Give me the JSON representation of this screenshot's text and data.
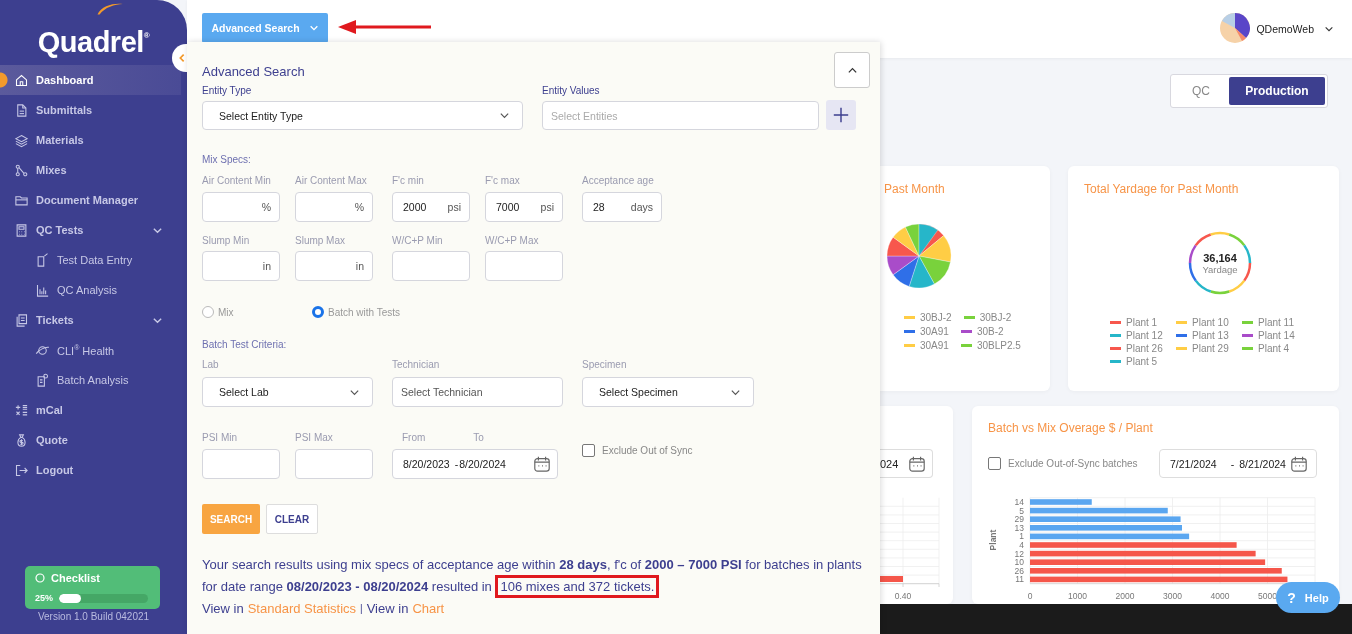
{
  "sidebar": {
    "logo": "Quadrel$^{®}$",
    "items": [
      {
        "label": "Dashboard",
        "selected": true
      },
      {
        "label": "Submittals",
        "selected": false
      },
      {
        "label": "Materials",
        "selected": false
      },
      {
        "label": "Mixes",
        "selected": false
      },
      {
        "label": "Document Manager",
        "selected": false
      },
      {
        "label": "QC Tests",
        "selected": false,
        "expanded": true,
        "children": [
          {
            "label": "Test Data Entry",
            "selected": false
          },
          {
            "label": "QC Analysis",
            "selected": false
          }
        ]
      },
      {
        "label": "Tickets",
        "selected": false,
        "expanded": true,
        "children": [
          {
            "label": "CLI$^{®}$ Health",
            "selected": false
          },
          {
            "label": "Batch Analysis",
            "selected": false
          }
        ]
      },
      {
        "label": "mCal",
        "selected": false
      },
      {
        "label": "Quote",
        "selected": false
      },
      {
        "label": "Logout",
        "selected": false
      }
    ],
    "checklist": {
      "label": "Checklist",
      "percent": "25%",
      "level": 0.25
    },
    "version": "Version 1.0 Build 042021"
  },
  "header": {
    "advanced_search_button": "Advanced Search",
    "annotation_arrow": true,
    "user": "QDemoWeb"
  },
  "mode_tabs": [
    {
      "label": "QC",
      "selected": false
    },
    {
      "label": "Production",
      "selected": true
    }
  ],
  "advanced_search": {
    "title": "Advanced Search",
    "entity_type": {
      "label": "Entity Type",
      "value": "Select Entity Type"
    },
    "entity_values": {
      "label": "Entity Values",
      "placeholder": "Select Entities"
    },
    "mix_specs_heading": "Mix Specs:",
    "mix_spec_rows": [
      [
        {
          "label": "Air Content Min",
          "unit": "%"
        },
        {
          "label": "Air Content Max",
          "unit": "%"
        },
        {
          "label": "F'c min",
          "value": "2000",
          "unit": "psi"
        },
        {
          "label": "F'c max",
          "value": "7000",
          "unit": "psi"
        },
        {
          "label": "Acceptance age",
          "value": "28",
          "unit": "days"
        }
      ],
      [
        {
          "label": "Slump Min",
          "unit": "in"
        },
        {
          "label": "Slump Max",
          "unit": "in"
        },
        {
          "label": "W/C+P Min"
        },
        {
          "label": "W/C+P Max"
        }
      ]
    ],
    "record_types": [
      {
        "label": "Mix",
        "selected": false
      },
      {
        "label": "Batch with Tests",
        "selected": true
      }
    ],
    "batch_heading": "Batch Test Criteria:",
    "lab": {
      "label": "Lab",
      "value": "Select Lab"
    },
    "technician": {
      "label": "Technician",
      "placeholder": "Select Technician"
    },
    "specimen": {
      "label": "Specimen",
      "value": "Select Specimen"
    },
    "psi_min": {
      "label": "PSI Min"
    },
    "psi_max": {
      "label": "PSI Max"
    },
    "date_range": {
      "from_label": "From",
      "to_label": "To",
      "start": "8/20/2023",
      "separator": "-",
      "end": "8/20/2024"
    },
    "exclude_out_of_sync": {
      "label": "Exclude Out of Sync",
      "checked": false
    },
    "buttons": [
      "SEARCH",
      "CLEAR"
    ],
    "summary": {
      "text": "Your search results using mix specs of acceptance age within **28 days**, f'c of **2000 – 7000 PSI** for batches in plants for date range **08/20/2023 - 08/20/2024** resulted in ",
      "highlighted": "106 mixes and 372 tickets."
    },
    "view_links": [
      {
        "prefix": "View in",
        "link": "Standard Statistics"
      },
      {
        "prefix": "View in",
        "link": "Chart"
      }
    ],
    "view_links_separator": "|"
  },
  "pie_card": {
    "title": "Past Month",
    "legend": [
      {
        "label": "30BJ-2",
        "color": "#ffcd45"
      },
      {
        "label": "30BJ-2",
        "color": "#79d23c"
      },
      {
        "label": "30A91",
        "color": "#2f6fe8"
      },
      {
        "label": "30B-2",
        "color": "#a94cc9"
      },
      {
        "label": "30A91",
        "color": "#ffcd45"
      },
      {
        "label": "30BLP2.5",
        "color": "#79d23c"
      }
    ]
  },
  "yardage_card": {
    "title": "Total Yardage for Past Month",
    "total": "36,164",
    "unit": "Yardage",
    "legend": [
      {
        "label": "Plant 1",
        "color": "#f7574d"
      },
      {
        "label": "Plant 10",
        "color": "#ffcd45"
      },
      {
        "label": "Plant 11",
        "color": "#79d23c"
      },
      {
        "label": "Plant 12",
        "color": "#26b6c9"
      },
      {
        "label": "Plant 13",
        "color": "#2f6fe8"
      },
      {
        "label": "Plant 14",
        "color": "#a94cc9"
      },
      {
        "label": "Plant 26",
        "color": "#f7574d"
      },
      {
        "label": "Plant 29",
        "color": "#ffcd45"
      },
      {
        "label": "Plant 4",
        "color": "#79d23c"
      },
      {
        "label": "Plant 5",
        "color": "#26b6c9"
      }
    ]
  },
  "left_chart_card": {
    "date_fragment": "024",
    "tick": "0.40"
  },
  "overage_card": {
    "title": "Batch vs Mix Overage $ / Plant",
    "exclude": {
      "label": "Exclude Out-of-Sync batches",
      "checked": false
    },
    "start": "7/21/2024",
    "separator": "-",
    "end": "8/21/2024",
    "chart_data": {
      "type": "bar",
      "orientation": "horizontal",
      "ylabel": "Plant",
      "stacked": true,
      "grid": true,
      "categories": [
        "14",
        "5",
        "29",
        "13",
        "1",
        "4",
        "12",
        "10",
        "26",
        "11"
      ],
      "xlim": [
        0,
        6000
      ],
      "xticks": [
        0,
        1000,
        2000,
        3000,
        4000,
        5000
      ],
      "series": [
        {
          "color": "#5aa6f0",
          "values": [
            1300,
            2900,
            3170,
            3200,
            3350,
            null,
            null,
            null,
            null,
            null
          ]
        },
        {
          "color": "#f5564a",
          "values": [
            null,
            null,
            null,
            null,
            null,
            4350,
            4750,
            4950,
            5300,
            5420
          ]
        }
      ]
    }
  },
  "help_button": {
    "icon": "?",
    "label": "Help"
  }
}
